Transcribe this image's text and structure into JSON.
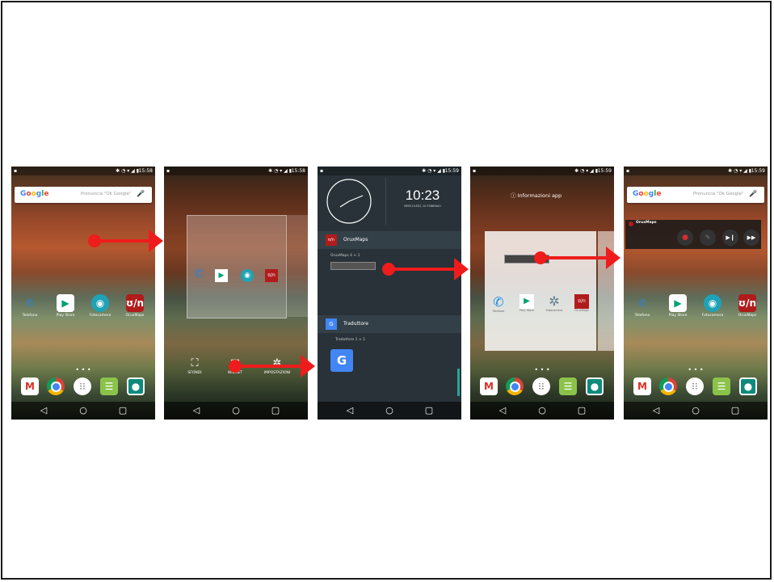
{
  "colors": {
    "arrow": "#ee1c1c",
    "widget_panel": "#283238",
    "widget_header": "#334048"
  },
  "screens": [
    {
      "status_time": "15:58",
      "search": {
        "logo": "Google",
        "hint": "Pronuncia \"Ok Google\""
      },
      "apps": [
        {
          "label": "Telefono",
          "icon": "phone-icon"
        },
        {
          "label": "Play Store",
          "icon": "play-store-icon"
        },
        {
          "label": "Fotocamera",
          "icon": "camera-icon"
        },
        {
          "label": "OruxMaps",
          "icon": "oruxmaps-icon"
        }
      ]
    },
    {
      "status_time": "15:58",
      "mini_apps": [
        {
          "label": "Telefono"
        },
        {
          "label": "Play Store"
        },
        {
          "label": "Fotocamera"
        },
        {
          "label": "OruxMaps"
        }
      ],
      "options": [
        {
          "label": "SFONDI",
          "icon": "wallpaper-icon"
        },
        {
          "label": "WIDGET",
          "icon": "widget-icon"
        },
        {
          "label": "IMPOSTAZIONI",
          "icon": "settings-icon"
        }
      ]
    },
    {
      "status_time": "15:59",
      "clock_digital": "10:23",
      "clock_date": "MERCOLEDÌ, 10 FEBBRAIO",
      "widget_apps": [
        {
          "name": "OruxMaps",
          "size": "OruxMaps 4 × 1"
        },
        {
          "name": "Traduttore",
          "size": "Traduttore 1 × 1"
        }
      ]
    },
    {
      "status_time": "15:59",
      "info_label": "Informazioni app",
      "mini_apps": [
        {
          "label": "Telefono"
        },
        {
          "label": "Play Store"
        },
        {
          "label": "Fotocamera"
        },
        {
          "label": "OruxMaps"
        }
      ]
    },
    {
      "status_time": "15:59",
      "search": {
        "logo": "Google",
        "hint": "Pronuncia \"Ok Google\""
      },
      "widget_title": "OruxMaps",
      "apps": [
        {
          "label": "Telefono",
          "icon": "phone-icon"
        },
        {
          "label": "Play Store",
          "icon": "play-store-icon"
        },
        {
          "label": "Fotocamera",
          "icon": "camera-icon"
        },
        {
          "label": "OruxMaps",
          "icon": "oruxmaps-icon"
        }
      ]
    }
  ],
  "dock_icons": [
    "gmail-icon",
    "chrome-icon",
    "app-drawer-icon",
    "hangouts-icon",
    "photos-icon"
  ],
  "nav_icons": [
    "back-icon",
    "home-icon",
    "recents-icon"
  ]
}
